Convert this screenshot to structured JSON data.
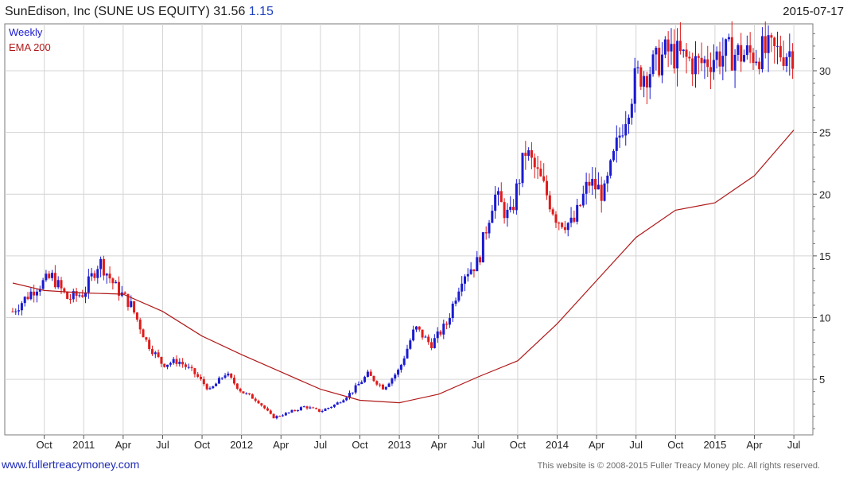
{
  "header": {
    "title": "SunEdison, Inc (SUNE US EQUITY) 31.56",
    "change": "1.15",
    "date": "2015-07-17"
  },
  "footer": {
    "website": "www.fullertreacymoney.com",
    "copyright": "This website is © 2008-2015 Fuller Treacy Money plc. All rights reserved."
  },
  "colors": {
    "up": "#1a1ad1",
    "down": "#e01b1b",
    "ema": "#b01818",
    "grid": "#d4d4d4"
  },
  "chart_data": {
    "type": "candlestick",
    "legend": [
      "Weekly",
      "EMA 200"
    ],
    "legend_position": "top-left",
    "x_tick_labels": [
      "Oct",
      "2011",
      "Apr",
      "Jul",
      "Oct",
      "2012",
      "Apr",
      "Jul",
      "Oct",
      "2013",
      "Apr",
      "Jul",
      "Oct",
      "2014",
      "Apr",
      "Jul",
      "Oct",
      "2015",
      "Apr",
      "Jul"
    ],
    "y_ticks": [
      5,
      10,
      15,
      20,
      25,
      30
    ],
    "ylim": [
      0.5,
      33.8
    ],
    "grid": true,
    "series": [
      {
        "name": "Weekly",
        "style": "candlestick",
        "x": [
          2010.55,
          2010.7,
          2010.8,
          2010.9,
          2011.0,
          2011.1,
          2011.2,
          2011.3,
          2011.4,
          2011.5,
          2011.6,
          2011.7,
          2011.8,
          2011.9,
          2012.0,
          2012.1,
          2012.2,
          2012.3,
          2012.4,
          2012.5,
          2012.6,
          2012.7,
          2012.8,
          2012.9,
          2013.0,
          2013.1,
          2013.2,
          2013.3,
          2013.4,
          2013.5,
          2013.6,
          2013.7,
          2013.8,
          2013.9,
          2014.0,
          2014.1,
          2014.2,
          2014.3,
          2014.4,
          2014.5,
          2014.6,
          2014.7,
          2014.8,
          2014.9,
          2015.0,
          2015.1,
          2015.2,
          2015.3,
          2015.4,
          2015.5
        ],
        "values": [
          10.5,
          12.5,
          13.3,
          11.5,
          12.0,
          14.6,
          12.5,
          11.0,
          8.0,
          6.2,
          6.5,
          5.5,
          4.1,
          5.5,
          4.0,
          3.3,
          1.9,
          2.3,
          2.8,
          2.4,
          3.0,
          4.0,
          5.4,
          4.3,
          5.8,
          9.2,
          7.8,
          9.5,
          13.5,
          14.5,
          20.0,
          18.0,
          23.5,
          21.0,
          18.0,
          17.5,
          21.0,
          20.0,
          25.0,
          29.5,
          30.2,
          31.56,
          31.0,
          30.5,
          31.2,
          31.4,
          31.3,
          31.5,
          31.5,
          31.56
        ]
      },
      {
        "name": "EMA 200",
        "style": "line",
        "x": [
          2010.55,
          2010.75,
          2011.0,
          2011.25,
          2011.5,
          2011.75,
          2012.0,
          2012.25,
          2012.5,
          2012.75,
          2013.0,
          2013.25,
          2013.5,
          2013.75,
          2014.0,
          2014.25,
          2014.5,
          2014.75,
          2015.0,
          2015.25,
          2015.5
        ],
        "values": [
          12.8,
          12.2,
          12.0,
          11.9,
          10.5,
          8.5,
          7.0,
          5.6,
          4.2,
          3.3,
          3.1,
          3.8,
          5.2,
          6.5,
          9.5,
          13.0,
          16.5,
          18.7,
          19.3,
          21.5,
          25.2
        ]
      }
    ]
  }
}
